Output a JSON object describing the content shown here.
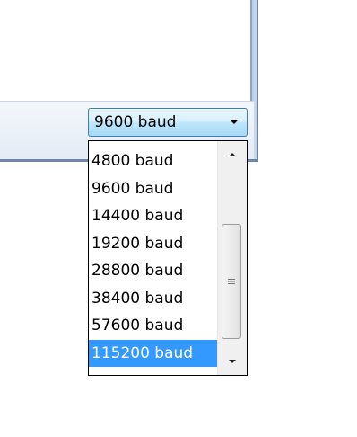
{
  "combo": {
    "value": "9600 baud",
    "icon": "chevron-down-icon"
  },
  "dropdown": {
    "options": [
      "4800 baud",
      "9600 baud",
      "14400 baud",
      "19200 baud",
      "28800 baud",
      "38400 baud",
      "57600 baud",
      "115200 baud"
    ],
    "highlighted": "115200 baud"
  },
  "scrollbar": {
    "up_icon": "scroll-up-arrow-icon",
    "down_icon": "scroll-down-arrow-icon",
    "grip_icon": "scroll-grip-icon"
  },
  "colors": {
    "highlight": "#3399ff",
    "combo_border": "#3c7fb1"
  }
}
